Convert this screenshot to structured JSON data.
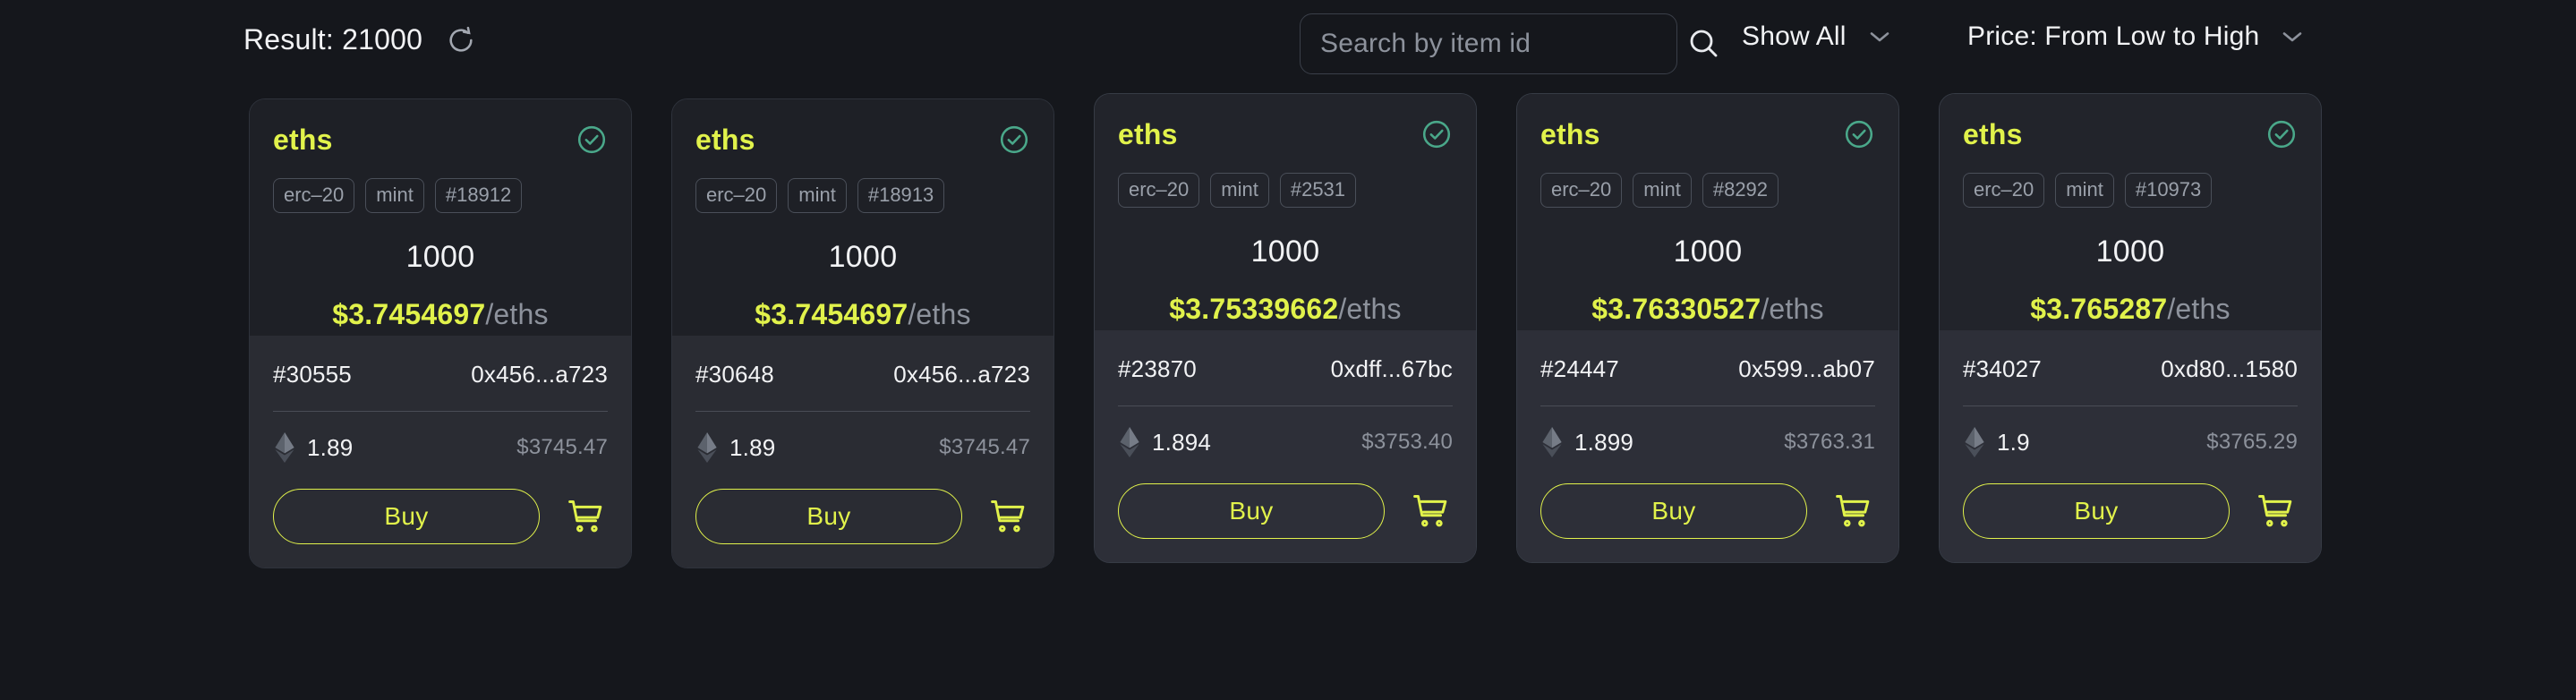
{
  "topbar": {
    "result_label": "Result: 21000",
    "refresh_icon": "refresh-icon",
    "search": {
      "placeholder": "Search by item id",
      "value": "",
      "search_icon": "search-icon"
    },
    "filter": {
      "label": "Show All",
      "chevron_icon": "chevron-down-icon"
    },
    "sort": {
      "label": "Price: From Low to High",
      "chevron_icon": "chevron-down-icon"
    }
  },
  "colors": {
    "page_bg": "#15171c",
    "card_top_bg": "#1e2026",
    "card_bottom_bg": "#2a2c33",
    "accent": "#e1f24b",
    "verified": "#4aa88a",
    "muted_text": "#8d929c",
    "primary_text": "#f2f3f5"
  },
  "cards": [
    {
      "ticker": "eths",
      "verified_icon": "verified-check-icon",
      "tags": [
        "erc–20",
        "mint",
        "#18912"
      ],
      "amount": "1000",
      "unit_price": "$3.7454697",
      "unit_suffix": "/eths",
      "listing_id": "#30555",
      "address": "0x456...a723",
      "eth_icon": "ethereum-icon",
      "eth_amount": "1.89",
      "usd_amount": "$3745.47",
      "buy_label": "Buy",
      "cart_icon": "cart-icon",
      "raised": false
    },
    {
      "ticker": "eths",
      "verified_icon": "verified-check-icon",
      "tags": [
        "erc–20",
        "mint",
        "#18913"
      ],
      "amount": "1000",
      "unit_price": "$3.7454697",
      "unit_suffix": "/eths",
      "listing_id": "#30648",
      "address": "0x456...a723",
      "eth_icon": "ethereum-icon",
      "eth_amount": "1.89",
      "usd_amount": "$3745.47",
      "buy_label": "Buy",
      "cart_icon": "cart-icon",
      "raised": false
    },
    {
      "ticker": "eths",
      "verified_icon": "verified-check-icon",
      "tags": [
        "erc–20",
        "mint",
        "#2531"
      ],
      "amount": "1000",
      "unit_price": "$3.75339662",
      "unit_suffix": "/eths",
      "listing_id": "#23870",
      "address": "0xdff...67bc",
      "eth_icon": "ethereum-icon",
      "eth_amount": "1.894",
      "usd_amount": "$3753.40",
      "buy_label": "Buy",
      "cart_icon": "cart-icon",
      "raised": true
    },
    {
      "ticker": "eths",
      "verified_icon": "verified-check-icon",
      "tags": [
        "erc–20",
        "mint",
        "#8292"
      ],
      "amount": "1000",
      "unit_price": "$3.76330527",
      "unit_suffix": "/eths",
      "listing_id": "#24447",
      "address": "0x599...ab07",
      "eth_icon": "ethereum-icon",
      "eth_amount": "1.899",
      "usd_amount": "$3763.31",
      "buy_label": "Buy",
      "cart_icon": "cart-icon",
      "raised": true
    },
    {
      "ticker": "eths",
      "verified_icon": "verified-check-icon",
      "tags": [
        "erc–20",
        "mint",
        "#10973"
      ],
      "amount": "1000",
      "unit_price": "$3.765287",
      "unit_suffix": "/eths",
      "listing_id": "#34027",
      "address": "0xd80...1580",
      "eth_icon": "ethereum-icon",
      "eth_amount": "1.9",
      "usd_amount": "$3765.29",
      "buy_label": "Buy",
      "cart_icon": "cart-icon",
      "raised": true
    }
  ]
}
